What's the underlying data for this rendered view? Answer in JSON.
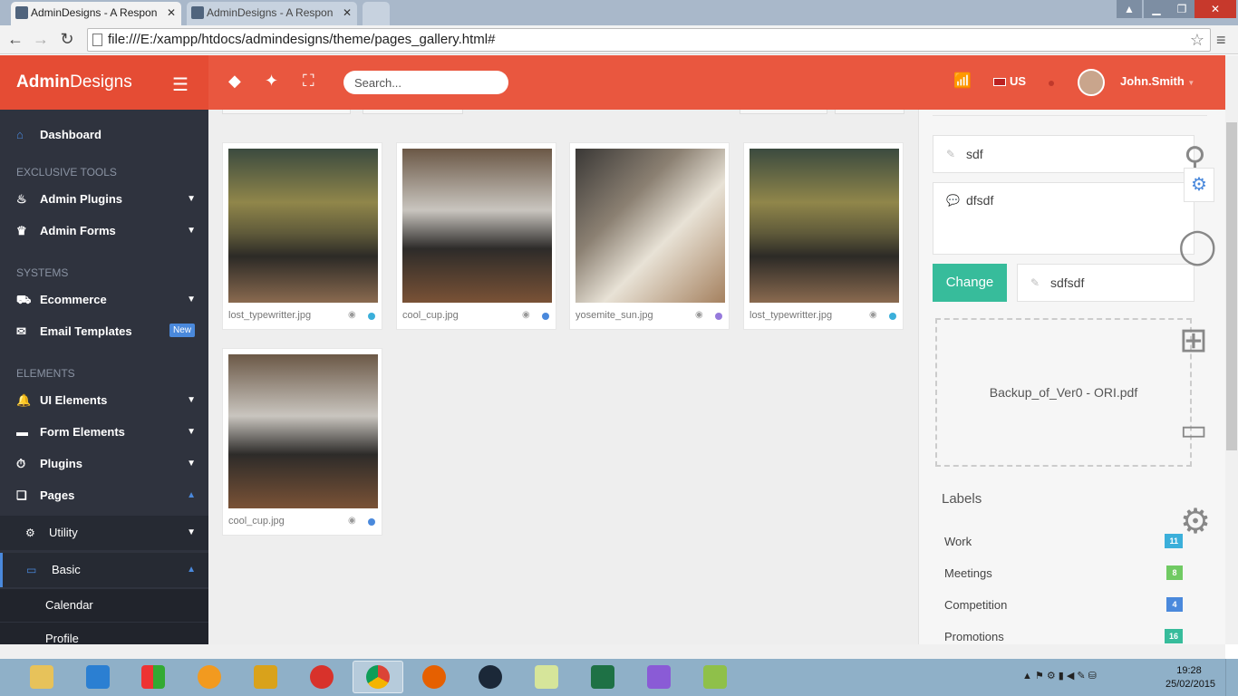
{
  "browser": {
    "tabs": [
      {
        "label": "AdminDesigns - A Respon"
      },
      {
        "label": "AdminDesigns - A Respon"
      }
    ],
    "url": "file:///E:/xampp/htdocs/admindesigns/theme/pages_gallery.html#"
  },
  "header": {
    "brand_bold": "Admin",
    "brand_rest": "Designs",
    "search_placeholder": "Search...",
    "lang": "US",
    "user": "John.Smith"
  },
  "sidebar": {
    "dashboard": "Dashboard",
    "section_exclusive": "EXCLUSIVE TOOLS",
    "admin_plugins": "Admin Plugins",
    "admin_forms": "Admin Forms",
    "section_systems": "SYSTEMS",
    "ecommerce": "Ecommerce",
    "email_templates": "Email Templates",
    "new_badge": "New",
    "section_elements": "ELEMENTS",
    "ui_elements": "UI Elements",
    "form_elements": "Form Elements",
    "plugins": "Plugins",
    "pages": "Pages",
    "utility": "Utility",
    "basic": "Basic",
    "calendar": "Calendar",
    "profile": "Profile"
  },
  "gallery": {
    "items": [
      {
        "name": "lost_typewritter.jpg",
        "dot_color": "#3bafda"
      },
      {
        "name": "cool_cup.jpg",
        "dot_color": "#4a89dc"
      },
      {
        "name": "yosemite_sun.jpg",
        "dot_color": "#967adc"
      },
      {
        "name": "lost_typewritter.jpg",
        "dot_color": "#3bafda"
      },
      {
        "name": "cool_cup.jpg",
        "dot_color": "#4a89dc"
      }
    ]
  },
  "panel": {
    "field1": "sdf",
    "textarea": "dfsdf",
    "change_button": "Change",
    "field2": "sdfsdf",
    "dropzone_file": "Backup_of_Ver0 - ORI.pdf",
    "labels_title": "Labels",
    "labels": [
      {
        "name": "Work",
        "count": "11",
        "color": "#3bafda"
      },
      {
        "name": "Meetings",
        "count": "8",
        "color": "#70ca63"
      },
      {
        "name": "Competition",
        "count": "4",
        "color": "#4a89dc"
      },
      {
        "name": "Promotions",
        "count": "16",
        "color": "#37bc9b"
      }
    ]
  },
  "taskbar": {
    "time": "19:28",
    "date": "25/02/2015"
  }
}
